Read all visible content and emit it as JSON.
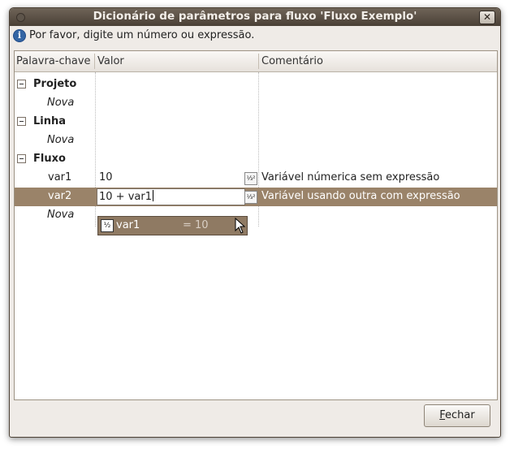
{
  "window": {
    "title": "Dicionário de parâmetros para fluxo 'Fluxo Exemplo'",
    "close_symbol": "✕"
  },
  "info": {
    "icon": "info-icon",
    "text": "Por favor, digite um número ou expressão."
  },
  "columns": {
    "keyword": "Palavra-chave",
    "value": "Valor",
    "comment": "Comentário"
  },
  "groups": [
    {
      "label": "Projeto",
      "new_label": "Nova"
    },
    {
      "label": "Linha",
      "new_label": "Nova"
    },
    {
      "label": "Fluxo",
      "new_label": "Nova",
      "items": [
        {
          "key": "var1",
          "value": "10",
          "type_icon": "1/3 2",
          "comment": "Variável númerica sem expressão"
        },
        {
          "key": "var2",
          "value": "10 + var1",
          "type_icon": "1/3 2",
          "comment": "Variável usando outra com expressão"
        }
      ]
    }
  ],
  "autocomplete": {
    "icon": "½",
    "name": "var1",
    "value": "= 10"
  },
  "buttons": {
    "close_mnemonic": "F",
    "close_rest": "echar"
  },
  "colors": {
    "selection": "#9a8369",
    "titlebar": "#4a4036"
  }
}
